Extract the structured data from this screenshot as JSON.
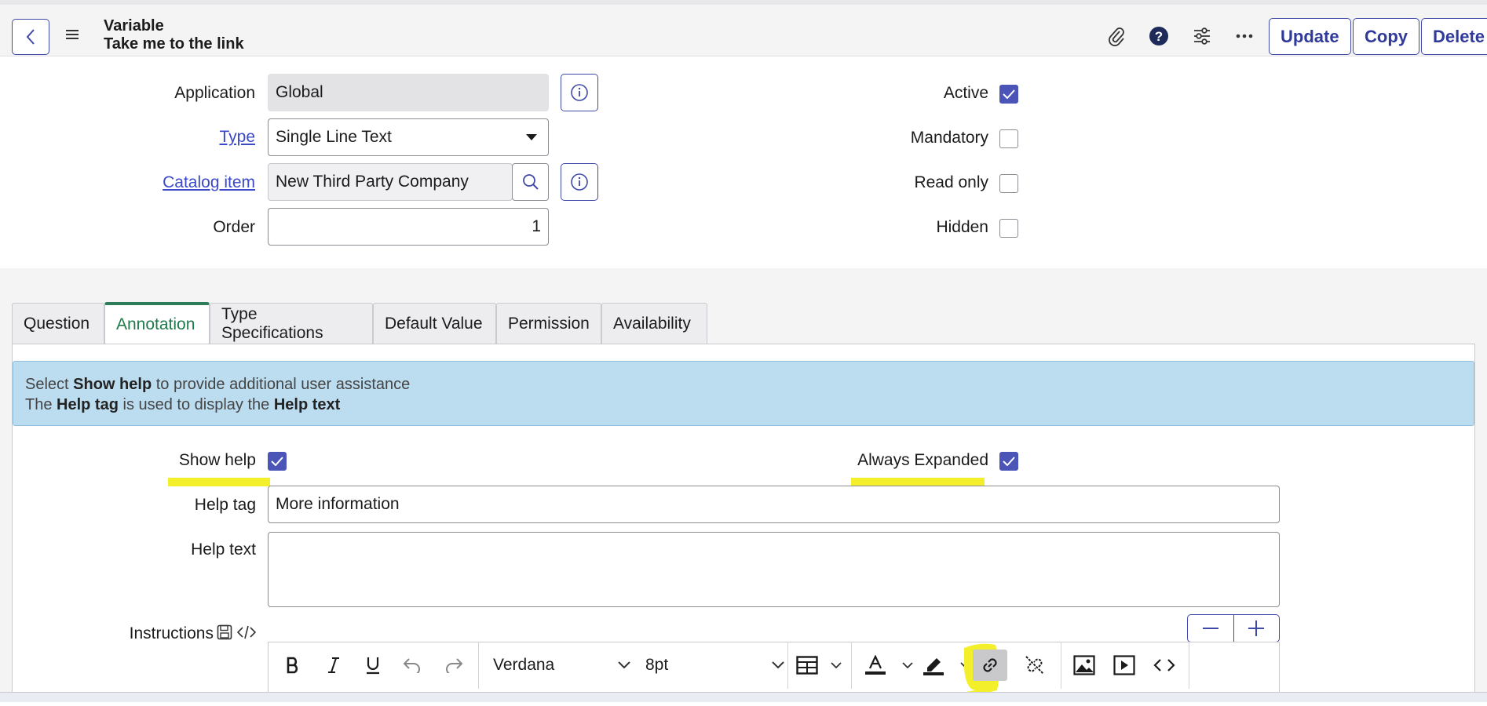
{
  "header": {
    "title": "Variable",
    "subtitle": "Take me to the link",
    "buttons": {
      "update": "Update",
      "copy": "Copy",
      "delete": "Delete"
    }
  },
  "form": {
    "application": {
      "label": "Application",
      "value": "Global"
    },
    "type": {
      "label": "Type",
      "value": "Single Line Text"
    },
    "catalog_item": {
      "label": "Catalog item",
      "value": "New Third Party Company"
    },
    "order": {
      "label": "Order",
      "value": "1"
    },
    "active": {
      "label": "Active",
      "checked": true
    },
    "mandatory": {
      "label": "Mandatory",
      "checked": false
    },
    "read_only": {
      "label": "Read only",
      "checked": false
    },
    "hidden": {
      "label": "Hidden",
      "checked": false
    }
  },
  "tabs": [
    {
      "label": "Question",
      "active": false
    },
    {
      "label": "Annotation",
      "active": true
    },
    {
      "label": "Type Specifications",
      "active": false
    },
    {
      "label": "Default Value",
      "active": false
    },
    {
      "label": "Permission",
      "active": false
    },
    {
      "label": "Availability",
      "active": false
    }
  ],
  "banner": {
    "line1_a": "Select ",
    "line1_b": "Show help",
    "line1_c": " to provide additional user assistance",
    "line2_a": "The ",
    "line2_b": "Help tag",
    "line2_c": " is used to display the ",
    "line2_d": "Help text"
  },
  "annotation": {
    "show_help": {
      "label": "Show help",
      "checked": true
    },
    "always_expanded": {
      "label": "Always Expanded",
      "checked": true
    },
    "help_tag": {
      "label": "Help tag",
      "value": "More information"
    },
    "help_text": {
      "label": "Help text",
      "value": ""
    },
    "instructions": {
      "label": "Instructions"
    }
  },
  "editor": {
    "font": "Verdana",
    "size": "8pt",
    "highlight_color": "#f3ef2a",
    "accent": "#3f4aa6"
  }
}
